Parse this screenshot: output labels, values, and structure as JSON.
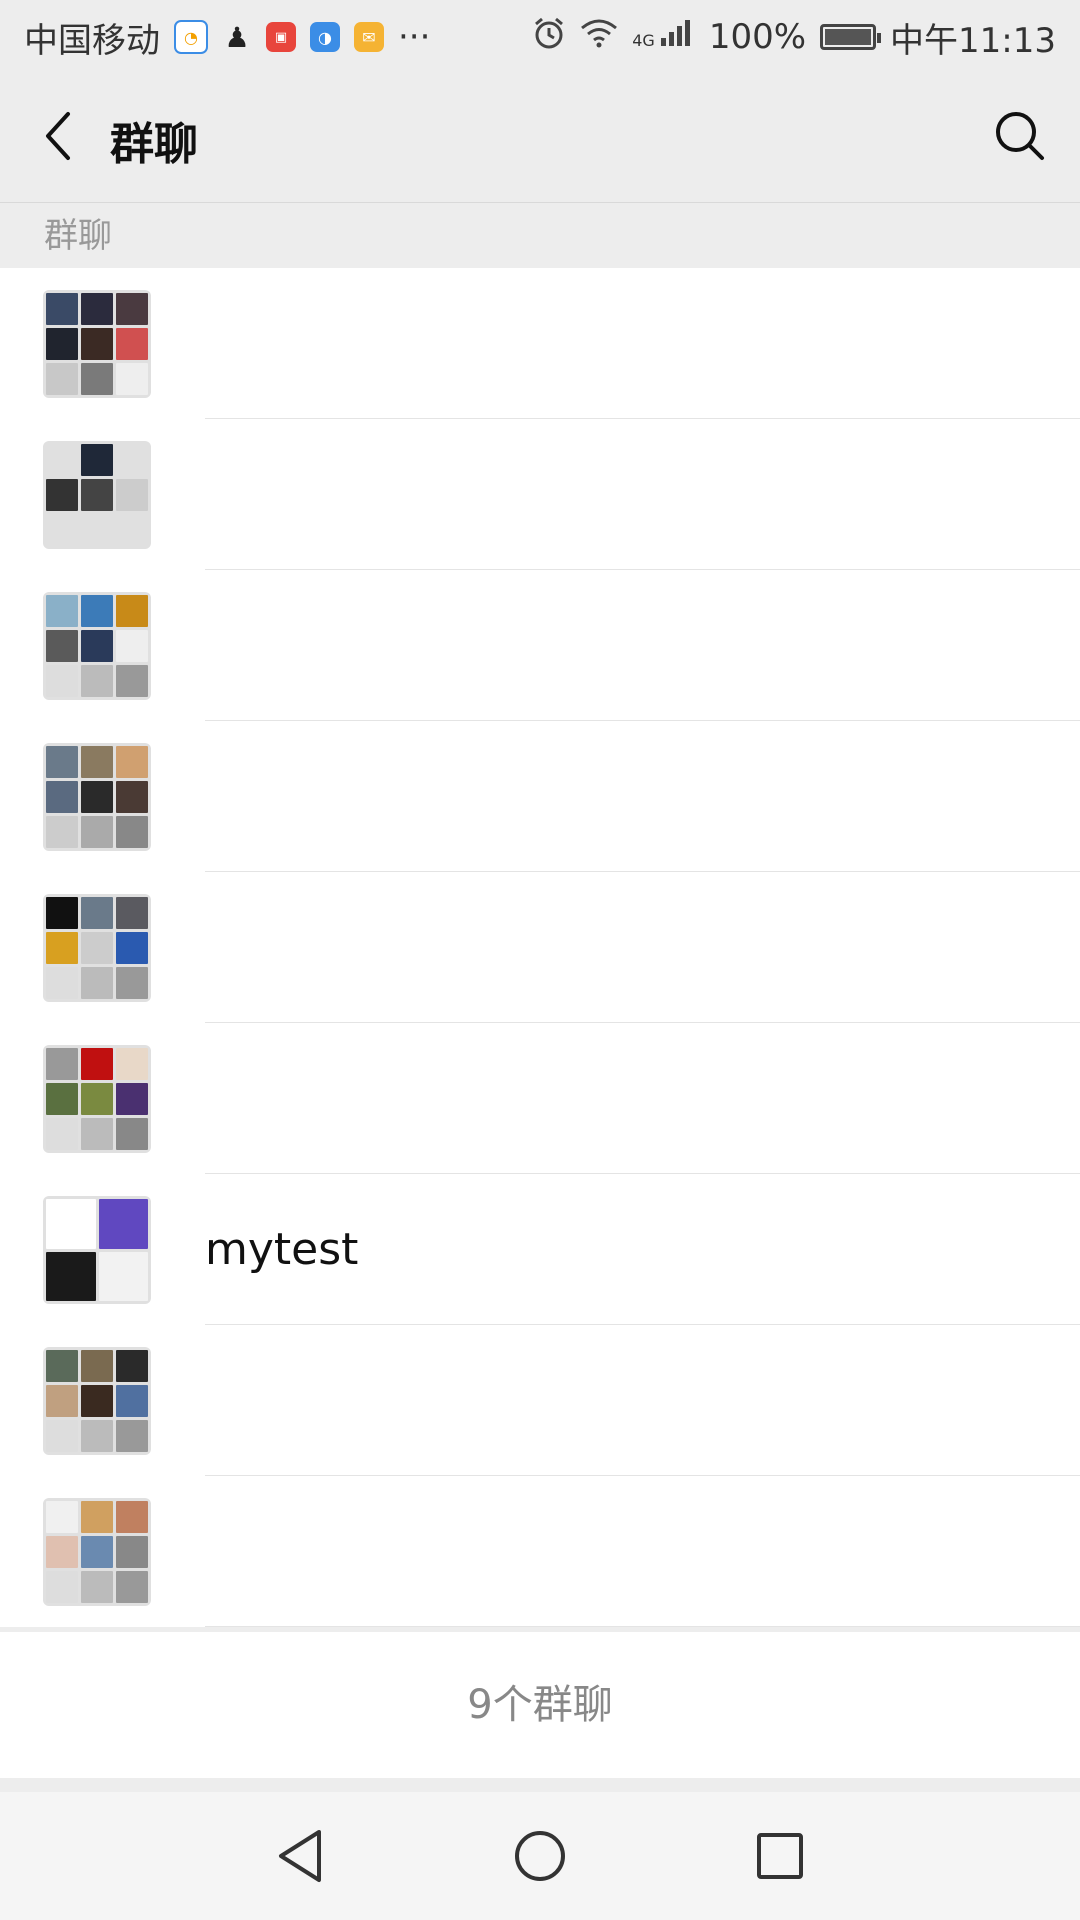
{
  "status_bar": {
    "carrier": "中国移动",
    "more": "···",
    "network": "4G",
    "battery": "100%",
    "time": "中午11:13",
    "notification_icons": [
      "clock-app-icon",
      "qq-icon",
      "toutiao-icon",
      "blue-app-icon",
      "mail-icon"
    ]
  },
  "header": {
    "title": "群聊",
    "back_icon": "chevron-left-icon",
    "search_icon": "search-icon"
  },
  "section": {
    "label": "群聊"
  },
  "groups": [
    {
      "name": "",
      "tiles": [
        "#3a4a66",
        "#2b2b3d",
        "#4a3a40",
        "#20242e",
        "#3b2a24",
        "#d05050",
        "#c8c8c8",
        "#7a7a7a",
        "#eee"
      ]
    },
    {
      "name": "",
      "tiles": [
        "#e0e0e0",
        "#1f2838",
        "#e0e0e0",
        "#333",
        "#444",
        "#ccc",
        "#e0e0e0",
        "#e0e0e0",
        "#e0e0e0"
      ]
    },
    {
      "name": "",
      "tiles": [
        "#8ab0c8",
        "#3c7bb8",
        "#c88a18",
        "#5a5a5a",
        "#2a3a5a",
        "#eee",
        "#ddd",
        "#bbb",
        "#999"
      ]
    },
    {
      "name": "",
      "tiles": [
        "#6a7a8a",
        "#8a7a60",
        "#d0a070",
        "#5a6a80",
        "#2a2a2a",
        "#4a3a34",
        "#ccc",
        "#aaa",
        "#888"
      ]
    },
    {
      "name": "",
      "tiles": [
        "#111",
        "#6a7a8a",
        "#5a5a60",
        "#d8a020",
        "#ccc",
        "#2a5ab0",
        "#ddd",
        "#bbb",
        "#999"
      ]
    },
    {
      "name": "",
      "tiles": [
        "#999",
        "#c01010",
        "#e8d8c8",
        "#5a7040",
        "#7a8a40",
        "#4a3070",
        "#ddd",
        "#bbb",
        "#888"
      ]
    },
    {
      "name": "mytest",
      "tiles": [
        "#ffffff",
        "#6048c0",
        "#1a1a1a",
        "#f2f2f2"
      ]
    },
    {
      "name": "",
      "tiles": [
        "#5a6a5a",
        "#7a6a50",
        "#2a2a2a",
        "#c0a080",
        "#3a2a20",
        "#5070a0",
        "#ddd",
        "#bbb",
        "#999"
      ]
    },
    {
      "name": "",
      "tiles": [
        "#f0f0f0",
        "#d0a060",
        "#c08060",
        "#e0c0b0",
        "#6a8ab0",
        "#888",
        "#ddd",
        "#bbb",
        "#999"
      ]
    }
  ],
  "footer": {
    "count_text": "9个群聊"
  },
  "nav": {
    "back": "triangle-back-icon",
    "home": "circle-home-icon",
    "recents": "square-recents-icon"
  }
}
